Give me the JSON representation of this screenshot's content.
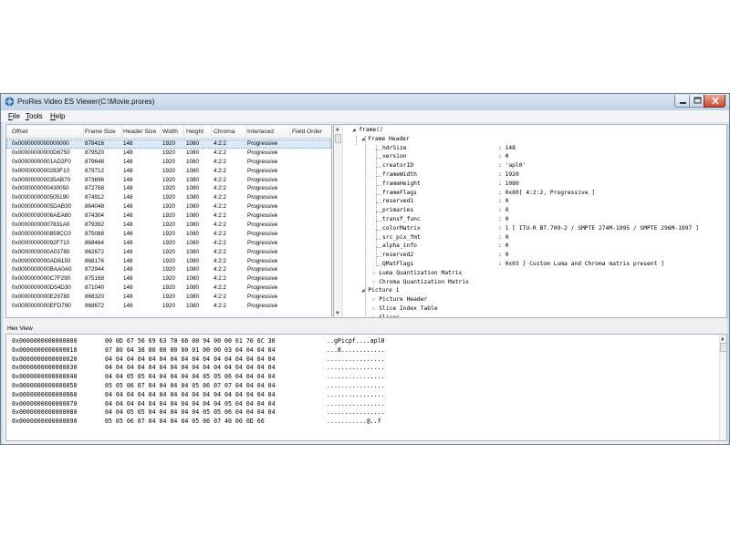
{
  "window": {
    "title": "ProRes Video ES Viewer(C:\\Movie.prores)",
    "app_icon": "prores-app-icon",
    "controls": [
      "minimize",
      "maximize",
      "close"
    ]
  },
  "menu": {
    "items": [
      {
        "key": "F",
        "rest": "ile"
      },
      {
        "key": "T",
        "rest": "ools"
      },
      {
        "key": "H",
        "rest": "elp"
      }
    ]
  },
  "list": {
    "columns": [
      "Offset",
      "Frame Size",
      "Header Size",
      "Width",
      "Height",
      "Chroma",
      "Interlaced",
      "Field Order"
    ],
    "rows": [
      [
        "0x0000000000000000",
        "878416",
        "148",
        "1920",
        "1080",
        "4:2:2",
        "Progressive",
        ""
      ],
      [
        "0x00000000000D6750",
        "879520",
        "148",
        "1920",
        "1080",
        "4:2:2",
        "Progressive",
        ""
      ],
      [
        "0x00000000001AD2F0",
        "879648",
        "148",
        "1920",
        "1080",
        "4:2:2",
        "Progressive",
        ""
      ],
      [
        "0x0000000000283F10",
        "879712",
        "148",
        "1920",
        "1080",
        "4:2:2",
        "Progressive",
        ""
      ],
      [
        "0x000000000035AB70",
        "873696",
        "148",
        "1920",
        "1080",
        "4:2:2",
        "Progressive",
        ""
      ],
      [
        "0x0000000000430050",
        "872768",
        "148",
        "1920",
        "1080",
        "4:2:2",
        "Progressive",
        ""
      ],
      [
        "0x0000000000505190",
        "874912",
        "148",
        "1920",
        "1080",
        "4:2:2",
        "Progressive",
        ""
      ],
      [
        "0x00000000005DAB30",
        "864048",
        "148",
        "1920",
        "1080",
        "4:2:2",
        "Progressive",
        ""
      ],
      [
        "0x00000000006AEA60",
        "874304",
        "148",
        "1920",
        "1080",
        "4:2:2",
        "Progressive",
        ""
      ],
      [
        "0x00000000007831A0",
        "879392",
        "148",
        "1920",
        "1080",
        "4:2:2",
        "Progressive",
        ""
      ],
      [
        "0x0000000000859CC0",
        "875088",
        "148",
        "1920",
        "1080",
        "4:2:2",
        "Progressive",
        ""
      ],
      [
        "0x000000000092F710",
        "868464",
        "148",
        "1920",
        "1080",
        "4:2:2",
        "Progressive",
        ""
      ],
      [
        "0x0000000000A03780",
        "862672",
        "148",
        "1920",
        "1080",
        "4:2:2",
        "Progressive",
        ""
      ],
      [
        "0x0000000000AD6150",
        "868176",
        "148",
        "1920",
        "1080",
        "4:2:2",
        "Progressive",
        ""
      ],
      [
        "0x0000000000BAA0A0",
        "872944",
        "148",
        "1920",
        "1080",
        "4:2:2",
        "Progressive",
        ""
      ],
      [
        "0x0000000000C7F290",
        "875168",
        "148",
        "1920",
        "1080",
        "4:2:2",
        "Progressive",
        ""
      ],
      [
        "0x0000000000D54D30",
        "871040",
        "148",
        "1920",
        "1080",
        "4:2:2",
        "Progressive",
        ""
      ],
      [
        "0x0000000000E29780",
        "868320",
        "148",
        "1920",
        "1080",
        "4:2:2",
        "Progressive",
        ""
      ],
      [
        "0x0000000000EFD790",
        "868672",
        "148",
        "1920",
        "1080",
        "4:2:2",
        "Progressive",
        ""
      ]
    ],
    "selected_index": 0
  },
  "tree": {
    "frame": "frame()",
    "frame_header": "Frame Header",
    "fields": [
      {
        "name": "hdrSize",
        "value": ": 148"
      },
      {
        "name": "version",
        "value": ": 0"
      },
      {
        "name": "creatorID",
        "value": ": 'apl0'"
      },
      {
        "name": "frameWidth",
        "value": ": 1920"
      },
      {
        "name": "frameHeight",
        "value": ": 1080"
      },
      {
        "name": "frameFlags",
        "value": ": 0x80[ 4:2:2, Progressive ]"
      },
      {
        "name": "reserved1",
        "value": ": 0"
      },
      {
        "name": "primaries",
        "value": ": 0"
      },
      {
        "name": "transf_func",
        "value": ": 0"
      },
      {
        "name": "colorMatrix",
        "value": ": 1 [ ITU-R BT.709-2 / SMPTE 274M-1995 / SMPTE 296M-1997 ]"
      },
      {
        "name": "src_pix_fmt",
        "value": ": 0"
      },
      {
        "name": "alpha_info",
        "value": ": 0"
      },
      {
        "name": "reserved2",
        "value": ": 0"
      },
      {
        "name": "QMatFlags",
        "value": ": 0x03 [ Custom Luma and Chroma matrix present ]"
      }
    ],
    "luma_matrix": "Luma Quantization Matrix",
    "chroma_matrix": "Chroma Quantization Matrix",
    "picture": "Picture 1",
    "picture_children": [
      "Picture Header",
      "Slice Index Table",
      "Slices"
    ]
  },
  "hex": {
    "label": "Hex View",
    "rows": [
      {
        "offset": "0x0000000000000000",
        "bytes": "00 0D 67 50 69 63 70 66 00 94 00 00 61 70 6C 30",
        "ascii": "..gPicpf....apl0"
      },
      {
        "offset": "0x0000000000000010",
        "bytes": "07 80 04 38 80 00 00 00 01 00 00 03 04 04 04 04",
        "ascii": "...8............"
      },
      {
        "offset": "0x0000000000000020",
        "bytes": "04 04 04 04 04 04 04 04 04 04 04 04 04 04 04 04",
        "ascii": "................"
      },
      {
        "offset": "0x0000000000000030",
        "bytes": "04 04 04 04 04 04 04 04 04 04 04 04 04 04 04 04",
        "ascii": "................"
      },
      {
        "offset": "0x0000000000000040",
        "bytes": "04 04 05 05 04 04 04 04 04 05 05 06 04 04 04 04",
        "ascii": "................"
      },
      {
        "offset": "0x0000000000000050",
        "bytes": "05 05 06 07 04 04 04 04 05 06 07 07 04 04 04 04",
        "ascii": "................"
      },
      {
        "offset": "0x0000000000000060",
        "bytes": "04 04 04 04 04 04 04 04 04 04 04 04 04 04 04 04",
        "ascii": "................"
      },
      {
        "offset": "0x0000000000000070",
        "bytes": "04 04 04 04 04 04 04 04 04 04 04 05 04 04 04 04",
        "ascii": "................"
      },
      {
        "offset": "0x0000000000000080",
        "bytes": "04 04 05 05 04 04 04 04 04 05 05 06 04 04 04 04",
        "ascii": "................"
      },
      {
        "offset": "0x0000000000000090",
        "bytes": "05 05 06 07 04 04 04 04 05 06 07 40 00 0D 66",
        "ascii": "...........@..f"
      }
    ]
  }
}
